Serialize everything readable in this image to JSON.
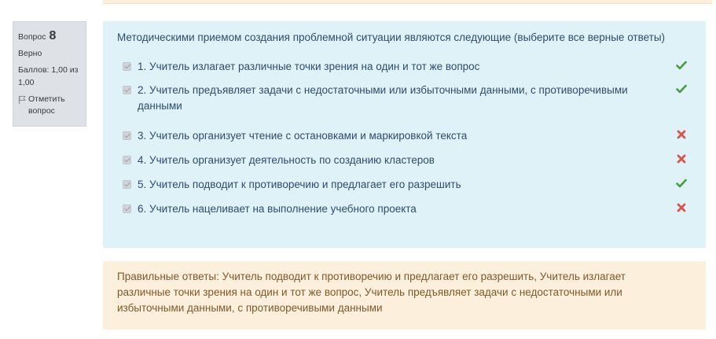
{
  "info": {
    "question_label": "Вопрос",
    "question_number": "8",
    "state": "Верно",
    "grade": "Баллов: 1,00 из 1,00",
    "flag_label": "Отметить вопрос"
  },
  "question": {
    "text": "Методическими приемом создания проблемной ситуации являются следующие (выберите все верные ответы)",
    "answers": [
      {
        "text": "1. Учитель излагает различные точки зрения на один и тот же вопрос",
        "checked": true,
        "result": "correct",
        "icon": "check-icon"
      },
      {
        "text": "2. Учитель предъявляет задачи с недостаточными или избыточными данными, с противоречивыми данными",
        "checked": true,
        "result": "correct",
        "icon": "check-icon"
      },
      {
        "text": "3. Учитель организует чтение с остановками и маркировкой текста",
        "checked": true,
        "result": "incorrect",
        "icon": "cross-icon"
      },
      {
        "text": "4. Учитель организует деятельность по созданию кластеров",
        "checked": true,
        "result": "incorrect",
        "icon": "cross-icon"
      },
      {
        "text": "5. Учитель подводит к противоречию и предлагает его разрешить",
        "checked": true,
        "result": "correct",
        "icon": "check-icon"
      },
      {
        "text": "6. Учитель нацеливает на выполнение учебного проекта",
        "checked": true,
        "result": "incorrect",
        "icon": "cross-icon"
      }
    ]
  },
  "feedback": {
    "right_answer": "Правильные ответы: Учитель подводит к противоречию и предлагает его разрешить, Учитель излагает различные точки зрения на один и тот же вопрос, Учитель предъявляет задачи с недостаточными или избыточными данными, с противоречивыми данными"
  },
  "colors": {
    "formulation_bg": "#def2f8",
    "feedback_bg": "#fcefdc",
    "info_bg": "#dee2e6",
    "correct": "#4a9b3f",
    "incorrect": "#d9534f"
  }
}
